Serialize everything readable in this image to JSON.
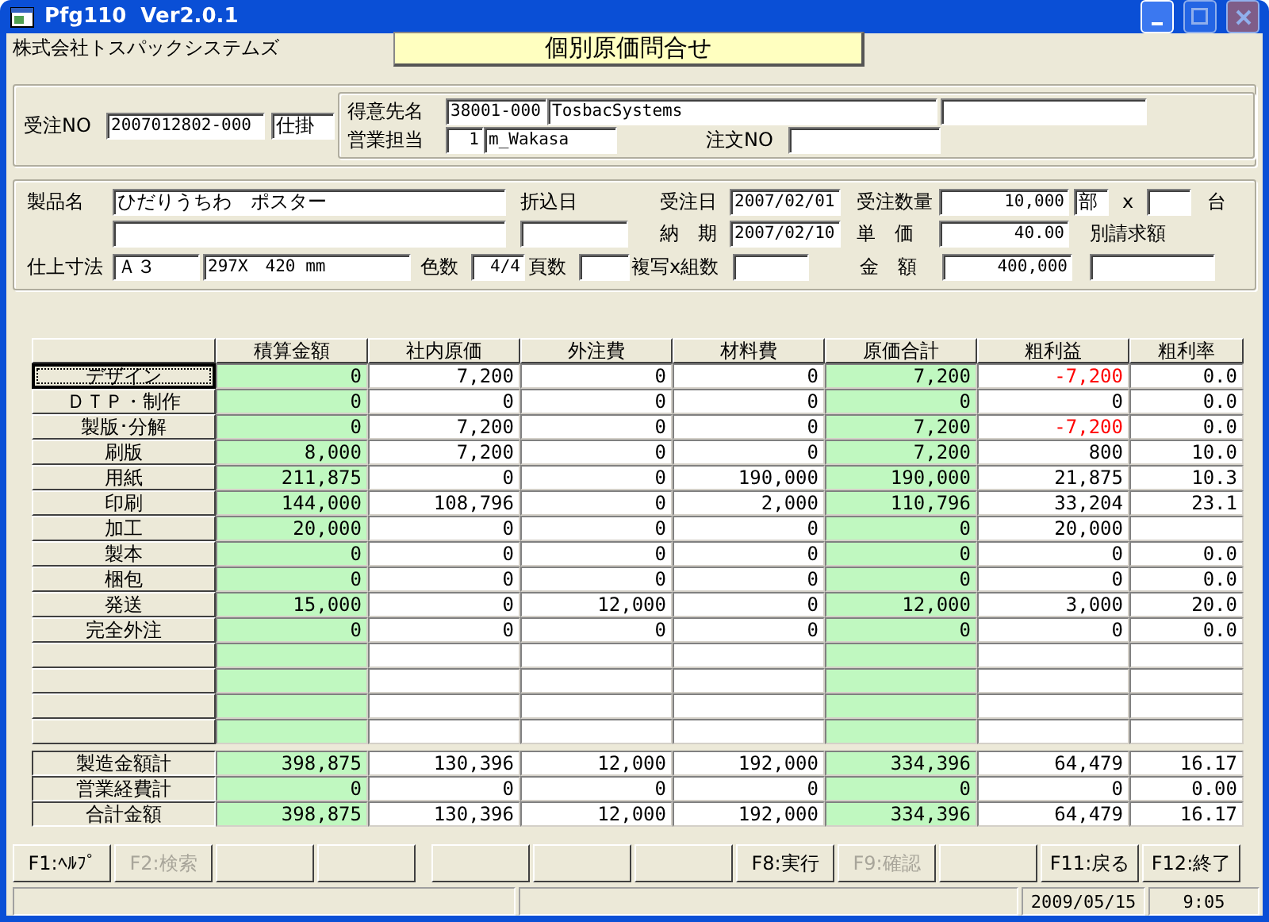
{
  "window": {
    "title": "Pfg110  Ver2.0.1",
    "title_buttons": [
      {
        "kind": "minimize",
        "disabled": false
      },
      {
        "kind": "maximize",
        "disabled": true
      },
      {
        "kind": "close",
        "disabled": true
      }
    ]
  },
  "company": "株式会社トスパックシステムズ",
  "banner": "個別原価問合せ",
  "order": {
    "no_label": "受注NO",
    "no": "2007012802-000",
    "status": "仕掛",
    "customer_label": "得意先名",
    "customer_code": "38001-000",
    "customer_name": "TosbacSystems",
    "sales_label": "営業担当",
    "sales_code": "1",
    "sales_name": "m_Wakasa",
    "po_label": "注文NO"
  },
  "product": {
    "name_label": "製品名",
    "name": "ひだりうちわ　ポスター",
    "insert_label": "折込日",
    "order_date_label": "受注日",
    "order_date": "2007/02/01",
    "due_label": "納　期",
    "due_date": "2007/02/10",
    "qty_label": "受注数量",
    "qty": "10,000",
    "qty_unit": "部",
    "times": "x",
    "machine_unit": "台",
    "price_label": "単　価",
    "price": "40.00",
    "extra_label": "別請求額",
    "size_label": "仕上寸法",
    "size": "Ａ３",
    "size_detail": "297X　420 mm",
    "colors_label": "色数",
    "colors": "4/4",
    "pages_label": "頁数",
    "copies_label": "複写x組数",
    "amount_label": "金　額",
    "amount": "400,000"
  },
  "table": {
    "columns": [
      {
        "label": "積算金額",
        "highlighted": true,
        "signed": false
      },
      {
        "label": "社内原価",
        "highlighted": false,
        "signed": false
      },
      {
        "label": "外注費",
        "highlighted": false,
        "signed": false
      },
      {
        "label": "材料費",
        "highlighted": false,
        "signed": false
      },
      {
        "label": "原価合計",
        "highlighted": true,
        "signed": false
      },
      {
        "label": "粗利益",
        "highlighted": false,
        "signed": true
      },
      {
        "label": "粗利率",
        "highlighted": false,
        "signed": false
      }
    ],
    "rows": [
      {
        "kind": "item",
        "label": "デザイン",
        "focused": true,
        "loss": true,
        "cells": [
          "0",
          "7,200",
          "0",
          "0",
          "7,200",
          "-7,200",
          "0.0"
        ]
      },
      {
        "kind": "item",
        "label": "ＤＴＰ・制作",
        "focused": false,
        "loss": false,
        "cells": [
          "0",
          "0",
          "0",
          "0",
          "0",
          "0",
          "0.0"
        ]
      },
      {
        "kind": "item",
        "label": "製版･分解",
        "focused": false,
        "loss": true,
        "cells": [
          "0",
          "7,200",
          "0",
          "0",
          "7,200",
          "-7,200",
          "0.0"
        ]
      },
      {
        "kind": "item",
        "label": "刷版",
        "focused": false,
        "loss": false,
        "cells": [
          "8,000",
          "7,200",
          "0",
          "0",
          "7,200",
          "800",
          "10.0"
        ]
      },
      {
        "kind": "item",
        "label": "用紙",
        "focused": false,
        "loss": false,
        "cells": [
          "211,875",
          "0",
          "0",
          "190,000",
          "190,000",
          "21,875",
          "10.3"
        ]
      },
      {
        "kind": "item",
        "label": "印刷",
        "focused": false,
        "loss": false,
        "cells": [
          "144,000",
          "108,796",
          "0",
          "2,000",
          "110,796",
          "33,204",
          "23.1"
        ]
      },
      {
        "kind": "item",
        "label": "加工",
        "focused": false,
        "loss": false,
        "cells": [
          "20,000",
          "0",
          "0",
          "0",
          "0",
          "20,000",
          null
        ]
      },
      {
        "kind": "item",
        "label": "製本",
        "focused": false,
        "loss": false,
        "cells": [
          "0",
          "0",
          "0",
          "0",
          "0",
          "0",
          "0.0"
        ]
      },
      {
        "kind": "item",
        "label": "梱包",
        "focused": false,
        "loss": false,
        "cells": [
          "0",
          "0",
          "0",
          "0",
          "0",
          "0",
          "0.0"
        ]
      },
      {
        "kind": "item",
        "label": "発送",
        "focused": false,
        "loss": false,
        "cells": [
          "15,000",
          "0",
          "12,000",
          "0",
          "12,000",
          "3,000",
          "20.0"
        ]
      },
      {
        "kind": "item",
        "label": "完全外注",
        "focused": false,
        "loss": false,
        "cells": [
          "0",
          "0",
          "0",
          "0",
          "0",
          "0",
          "0.0"
        ]
      },
      {
        "kind": "blank"
      },
      {
        "kind": "blank"
      },
      {
        "kind": "blank"
      },
      {
        "kind": "blank"
      },
      {
        "kind": "total",
        "label": "製造金額計",
        "loss": false,
        "cells": [
          "398,875",
          "130,396",
          "12,000",
          "192,000",
          "334,396",
          "64,479",
          "16.17"
        ]
      },
      {
        "kind": "total",
        "label": "営業経費計",
        "loss": false,
        "cells": [
          "0",
          "0",
          "0",
          "0",
          "0",
          "0",
          "0.00"
        ]
      },
      {
        "kind": "total",
        "label": "合計金額",
        "loss": false,
        "cells": [
          "398,875",
          "130,396",
          "12,000",
          "192,000",
          "334,396",
          "64,479",
          "16.17"
        ]
      }
    ]
  },
  "function_key_groups": [
    {
      "keys": [
        {
          "kind": "key",
          "label": "F1:ﾍﾙﾌﾟ",
          "disabled": false
        },
        {
          "kind": "key",
          "label": "F2:検索",
          "disabled": true
        },
        {
          "kind": "blank"
        },
        {
          "kind": "blank"
        }
      ]
    },
    {
      "keys": [
        {
          "kind": "blank"
        },
        {
          "kind": "blank"
        },
        {
          "kind": "blank"
        },
        {
          "kind": "key",
          "label": "F8:実行",
          "disabled": false
        },
        {
          "kind": "key",
          "label": "F9:確認",
          "disabled": true
        },
        {
          "kind": "blank"
        },
        {
          "kind": "key",
          "label": "F11:戻る",
          "disabled": false
        },
        {
          "kind": "key",
          "label": "F12:終了",
          "disabled": false
        }
      ]
    }
  ],
  "status_bar": {
    "date": "2009/05/15",
    "time": "9:05"
  }
}
